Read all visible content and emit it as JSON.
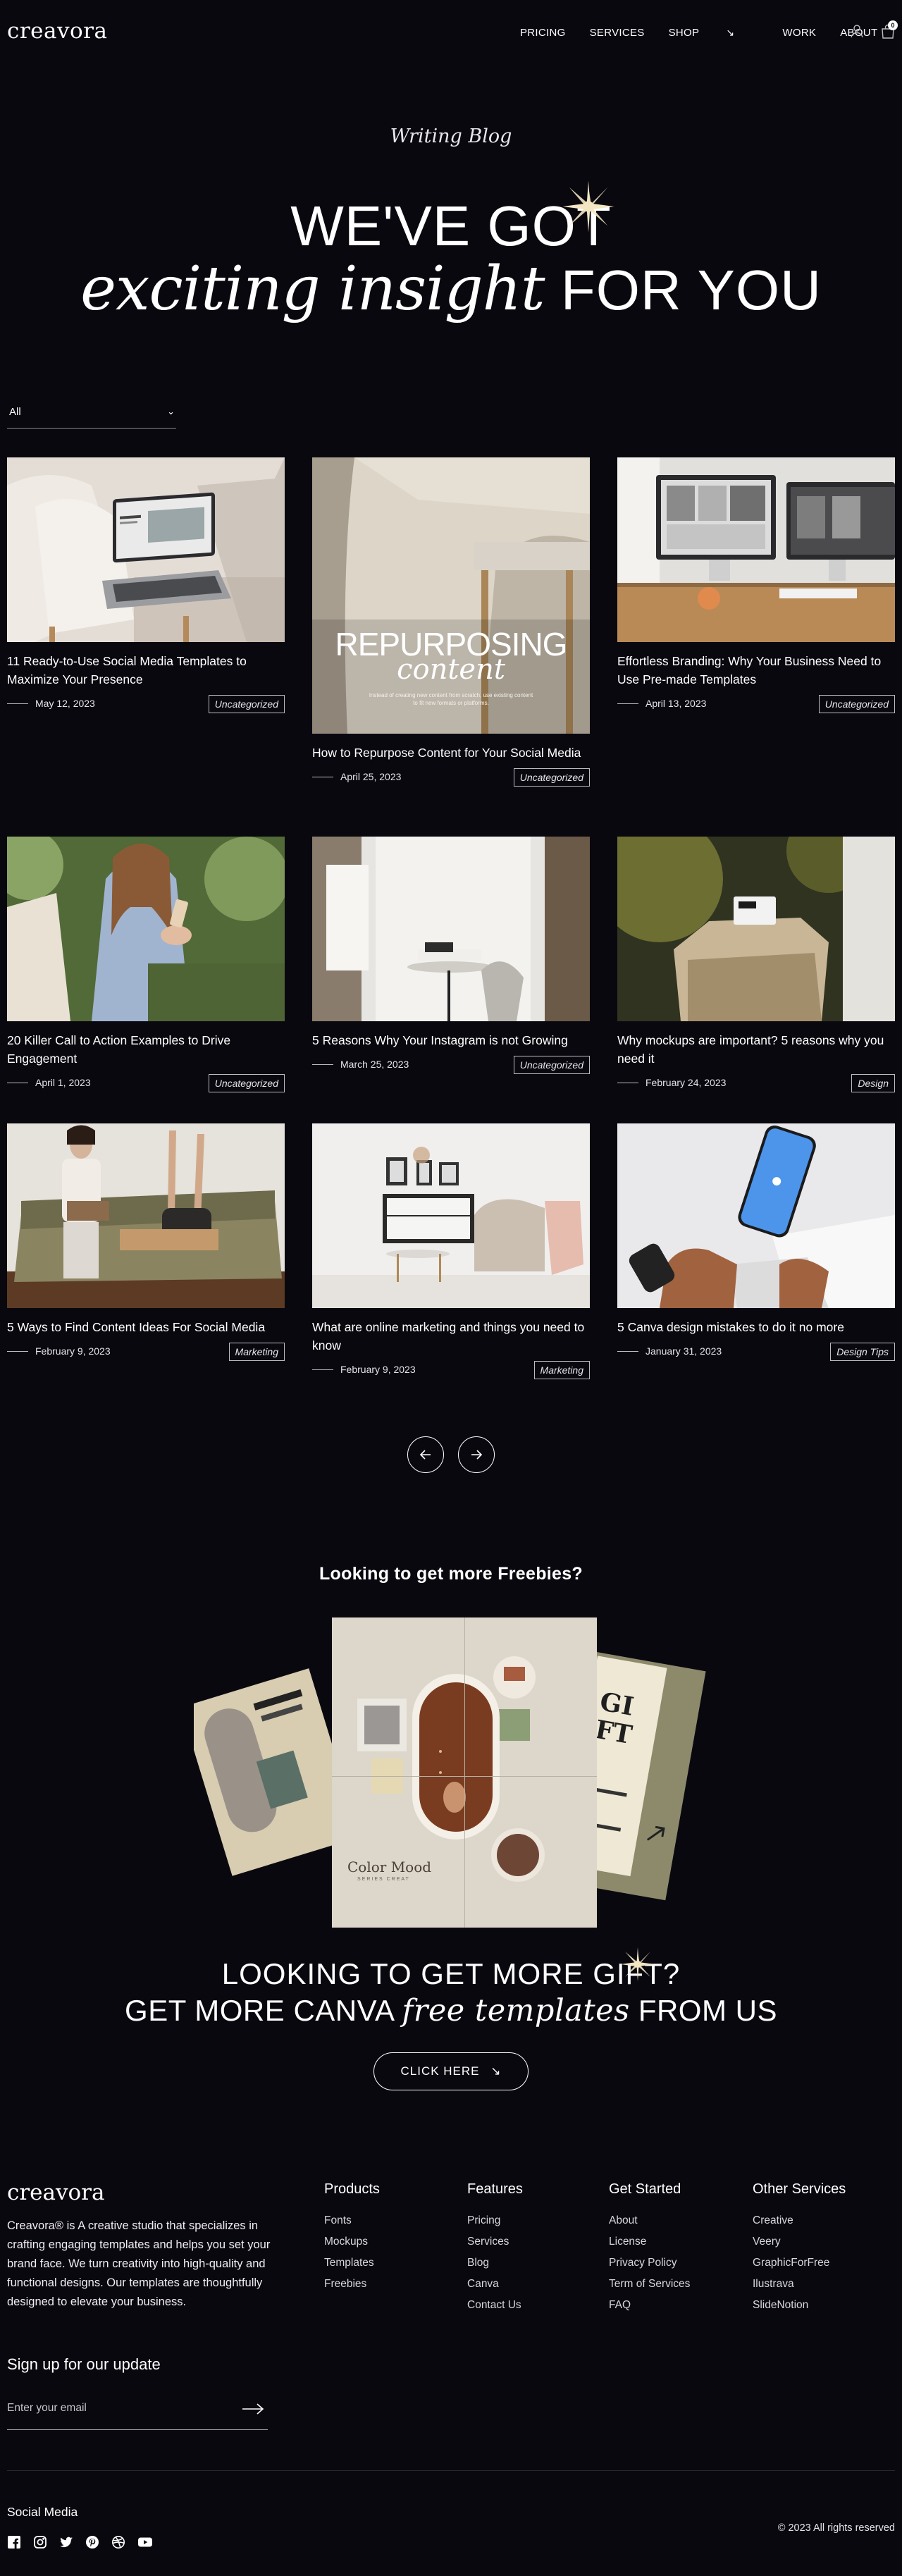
{
  "header": {
    "logo": "creavora",
    "nav": [
      "PRICING",
      "SERVICES",
      "SHOP",
      "WORK",
      "ABOUT"
    ],
    "cart_count": "0"
  },
  "hero": {
    "kicker": "Writing Blog",
    "line1": "WE'VE GOT",
    "line2_serif": "exciting insight",
    "line2_rest": "FOR YOU"
  },
  "filter": {
    "selected": "All"
  },
  "posts": [
    {
      "title": "11 Ready-to-Use Social Media Templates to Maximize Your Presence",
      "date": "May 12, 2023",
      "tag": "Uncategorized"
    },
    {
      "title": "How to Repurpose Content for Your Social Media",
      "date": "April 25, 2023",
      "tag": "Uncategorized",
      "image_text1": "REPURPOSING",
      "image_text2": "content",
      "image_text3": "Instead of creating new content from scratch, use existing content to fit new formats or platforms."
    },
    {
      "title": "Effortless Branding: Why Your Business Need to Use Pre-made Templates",
      "date": "April 13, 2023",
      "tag": "Uncategorized"
    },
    {
      "title": "20 Killer Call to Action Examples to Drive Engagement",
      "date": "April 1, 2023",
      "tag": "Uncategorized"
    },
    {
      "title": "5 Reasons Why Your Instagram is not Growing",
      "date": "March 25, 2023",
      "tag": "Uncategorized"
    },
    {
      "title": "Why mockups are important? 5 reasons why you need it",
      "date": "February 24, 2023",
      "tag": "Design"
    },
    {
      "title": "5 Ways to Find Content Ideas For Social Media",
      "date": "February 9, 2023",
      "tag": "Marketing"
    },
    {
      "title": "What are online marketing and things you need to know",
      "date": "February 9, 2023",
      "tag": "Marketing"
    },
    {
      "title": "5 Canva design mistakes to do it no more",
      "date": "January 31, 2023",
      "tag": "Design Tips"
    }
  ],
  "freebies": {
    "title": "Looking to get more Freebies?",
    "collage_center": "Color Mood",
    "collage_center_sub": "SERIES CREAT",
    "collage_right": "GI FT",
    "gift_line1": "LOOKING TO GET MORE GIFT?",
    "gift_line2_pre": "GET MORE CANVA",
    "gift_line2_serif": "free templates",
    "gift_line2_post": "FROM US",
    "cta": "CLICK HERE"
  },
  "footer": {
    "logo": "creavora",
    "about": "Creavora® is A creative studio that specializes in crafting engaging templates and helps you set your brand face. We turn creativity into high-quality and functional designs. Our templates are thoughtfully designed to elevate your business.",
    "columns": [
      {
        "heading": "Products",
        "items": [
          "Fonts",
          "Mockups",
          "Templates",
          "Freebies"
        ]
      },
      {
        "heading": "Features",
        "items": [
          "Pricing",
          "Services",
          "Blog",
          "Canva",
          "Contact Us"
        ]
      },
      {
        "heading": "Get Started",
        "items": [
          "About",
          "License",
          "Privacy Policy",
          "Term of Services",
          "FAQ"
        ]
      },
      {
        "heading": "Other Services",
        "items": [
          "Creative",
          "Veery",
          "GraphicForFree",
          "Ilustrava",
          "SlideNotion"
        ]
      }
    ],
    "signup_title": "Sign up for our update",
    "email_placeholder": "Enter your email",
    "social_title": "Social Media",
    "social_icons": [
      "facebook-icon",
      "instagram-icon",
      "twitter-icon",
      "pinterest-icon",
      "dribbble-icon",
      "youtube-icon"
    ],
    "copyright": "© 2023 All rights reserved"
  }
}
